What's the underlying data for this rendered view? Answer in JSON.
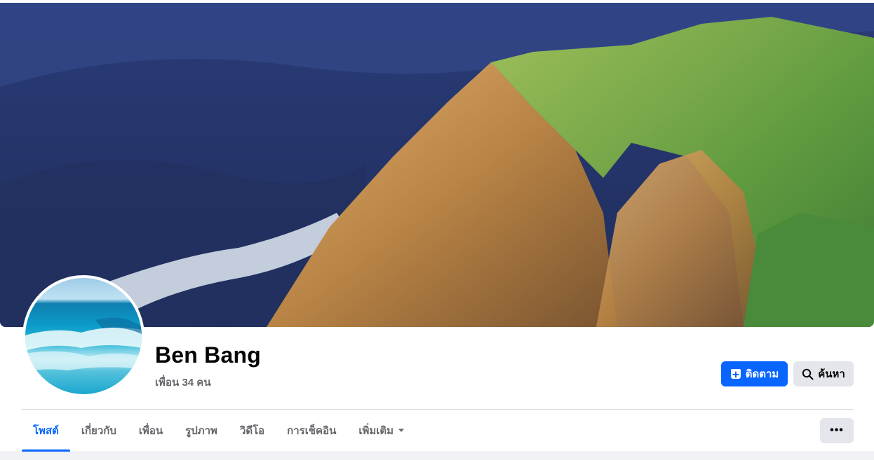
{
  "profile": {
    "name": "Ben Bang",
    "friends": "เพื่อน 34 คน"
  },
  "actions": {
    "follow_label": "ติดตาม",
    "search_label": "ค้นหา",
    "more_label": "•••"
  },
  "tabs": [
    {
      "label": "โพสต์",
      "active": true
    },
    {
      "label": "เกี่ยวกับ",
      "active": false
    },
    {
      "label": "เพื่อน",
      "active": false
    },
    {
      "label": "รูปภาพ",
      "active": false
    },
    {
      "label": "วิดีโอ",
      "active": false
    },
    {
      "label": "การเช็คอิน",
      "active": false
    },
    {
      "label": "เพิ่มเติม",
      "active": false
    }
  ],
  "colors": {
    "accent": "#0866ff",
    "secondary_button": "#e4e6eb",
    "muted_text": "#65676b"
  },
  "icons": {
    "follow": "add-follow-icon",
    "search": "search-icon",
    "more_dropdown": "caret-down-icon",
    "overflow": "more-horizontal-icon"
  }
}
